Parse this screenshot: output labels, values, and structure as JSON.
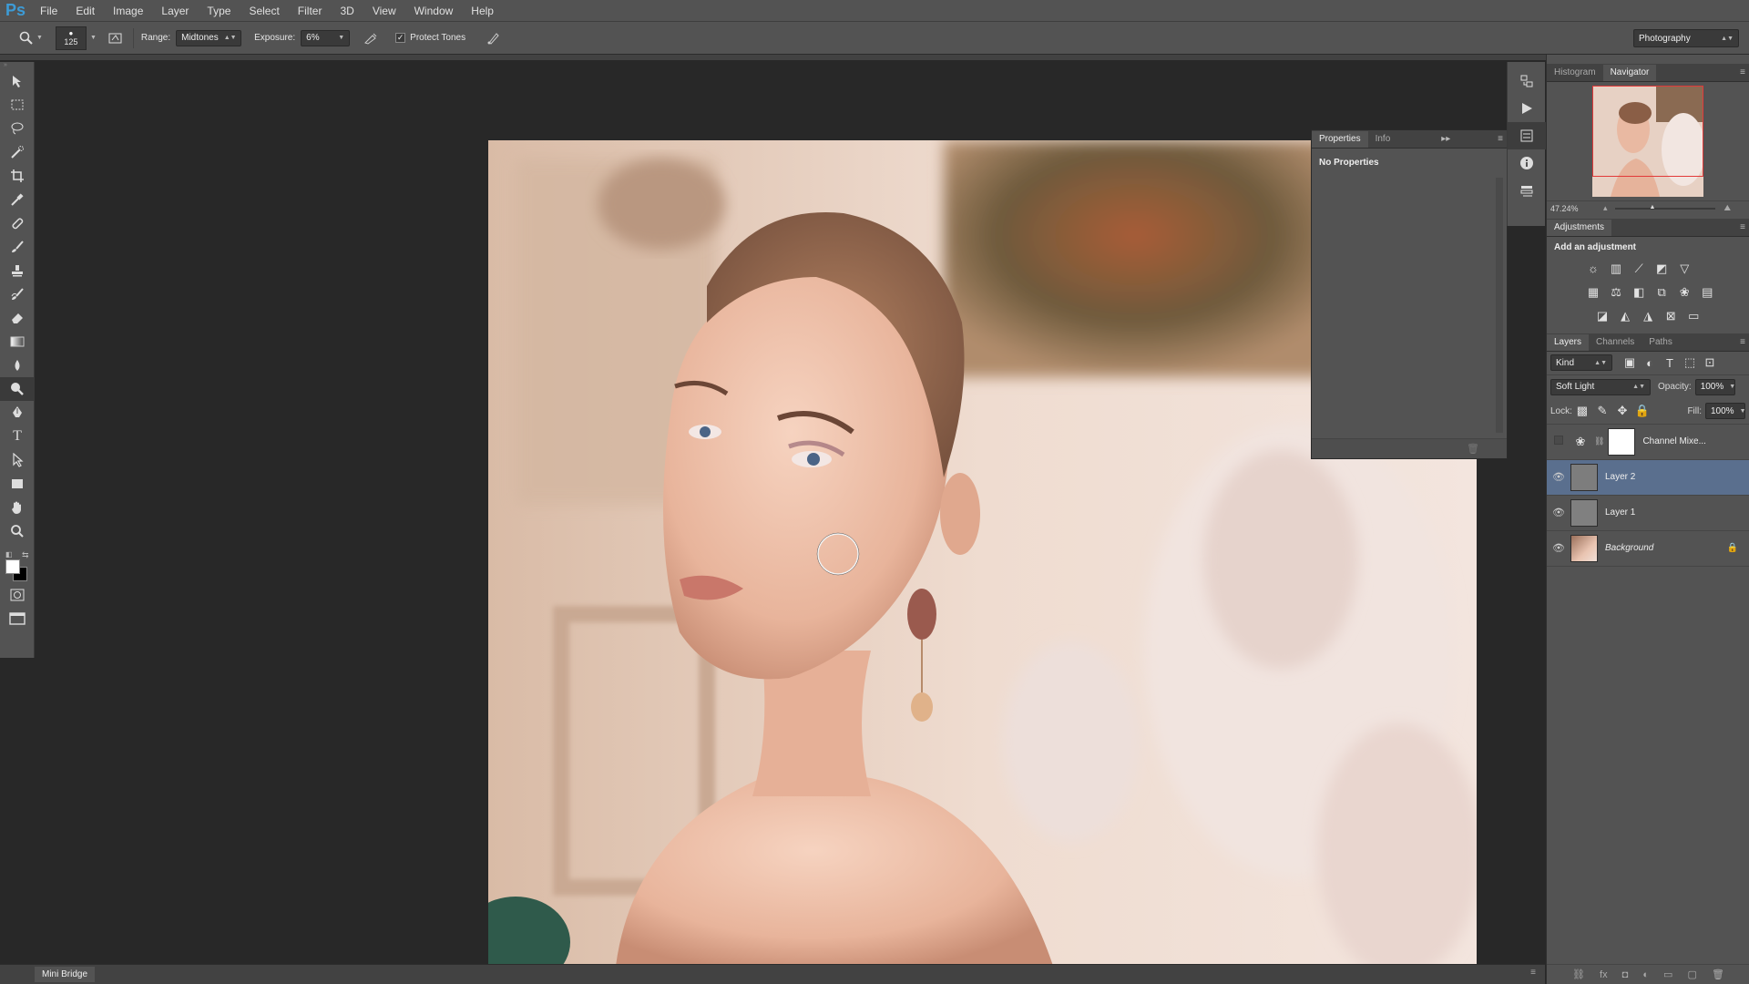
{
  "app": {
    "logo": "Ps"
  },
  "menu": [
    "File",
    "Edit",
    "Image",
    "Layer",
    "Type",
    "Select",
    "Filter",
    "3D",
    "View",
    "Window",
    "Help"
  ],
  "options": {
    "brush_size": "125",
    "range_label": "Range:",
    "range_value": "Midtones",
    "exposure_label": "Exposure:",
    "exposure_value": "6%",
    "protect_tones_label": "Protect Tones",
    "protect_tones_checked": true,
    "workspace": "Photography"
  },
  "tools": [
    "move-tool-icon",
    "marquee-tool-icon",
    "lasso-tool-icon",
    "quick-select-tool-icon",
    "crop-tool-icon",
    "eyedropper-tool-icon",
    "healing-brush-tool-icon",
    "brush-tool-icon",
    "clone-stamp-tool-icon",
    "history-brush-tool-icon",
    "eraser-tool-icon",
    "gradient-tool-icon",
    "blur-tool-icon",
    "dodge-tool-icon",
    "pen-tool-icon",
    "type-tool-icon",
    "path-selection-tool-icon",
    "rectangle-tool-icon",
    "hand-tool-icon",
    "zoom-tool-icon"
  ],
  "properties_panel": {
    "tabs": [
      "Properties",
      "Info"
    ],
    "text": "No Properties"
  },
  "navigator": {
    "tabs": [
      "Histogram",
      "Navigator"
    ],
    "zoom": "47.24%"
  },
  "adjustments": {
    "title": "Adjustments",
    "subtitle": "Add an adjustment"
  },
  "layers_panel": {
    "tabs": [
      "Layers",
      "Channels",
      "Paths"
    ],
    "filter": "Kind",
    "blend_mode": "Soft Light",
    "opacity_label": "Opacity:",
    "opacity": "100%",
    "lock_label": "Lock:",
    "fill_label": "Fill:",
    "fill": "100%",
    "layers": [
      {
        "name": "Channel Mixe...",
        "visible": false,
        "selected": false
      },
      {
        "name": "Layer 2",
        "visible": true,
        "selected": true
      },
      {
        "name": "Layer 1",
        "visible": true,
        "selected": false
      },
      {
        "name": "Background",
        "visible": true,
        "selected": false
      }
    ]
  },
  "mini_bridge": "Mini Bridge"
}
